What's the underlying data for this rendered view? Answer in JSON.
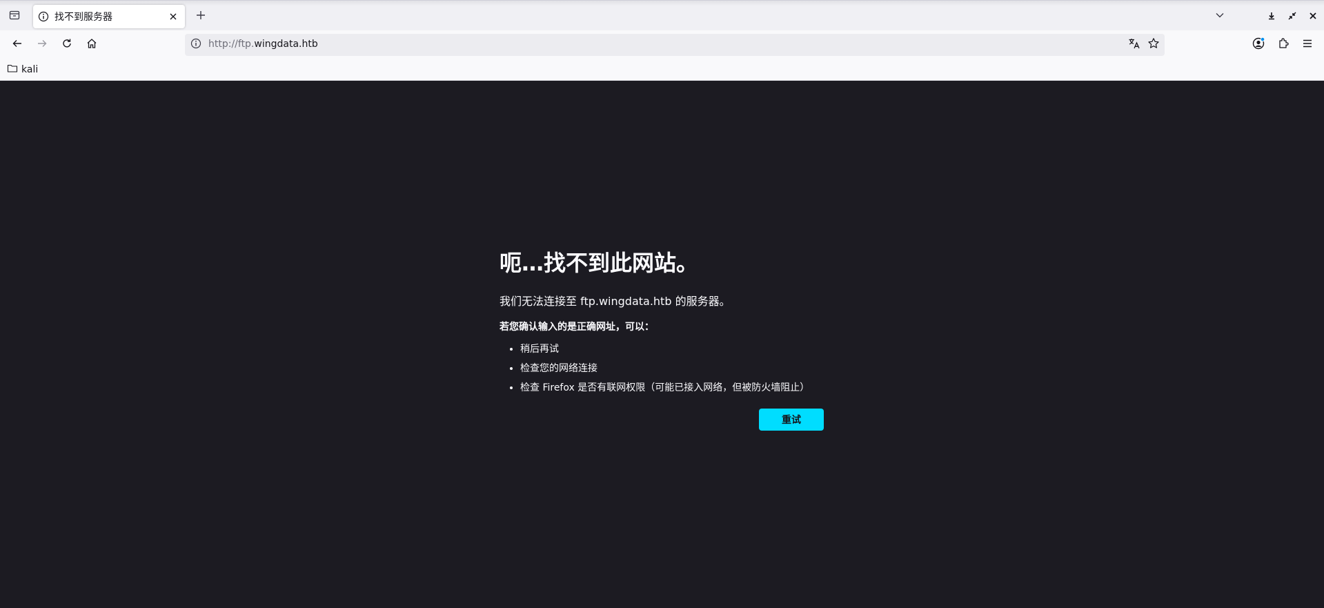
{
  "browser": {
    "tab": {
      "title": "找不到服务器"
    },
    "address": {
      "prefix": "http://ftp.",
      "domain": "wingdata.htb"
    },
    "bookmarks": [
      {
        "label": "kali"
      }
    ]
  },
  "page": {
    "title": "呃…找不到此网站。",
    "intro": "我们无法连接至 ftp.wingdata.htb 的服务器。",
    "hint": "若您确认输入的是正确网址，可以：",
    "suggestions": [
      "稍后再试",
      "检查您的网络连接",
      "检查 Firefox 是否有联网权限（可能已接入网络，但被防火墙阻止）"
    ],
    "retry_label": "重试"
  },
  "colors": {
    "content_bg": "#1c1b22",
    "accent": "#00ddff",
    "text": "#fbfbfe",
    "chrome_bg": "#f9f9fb"
  },
  "icons": [
    "tab-overview-icon",
    "info-icon",
    "close-icon",
    "plus-icon",
    "chevron-down-icon",
    "download-icon",
    "restore-icon",
    "back-arrow-icon",
    "forward-arrow-icon",
    "reload-icon",
    "home-icon",
    "translate-icon",
    "star-icon",
    "account-icon",
    "extensions-icon",
    "hamburger-menu-icon",
    "folder-icon"
  ]
}
